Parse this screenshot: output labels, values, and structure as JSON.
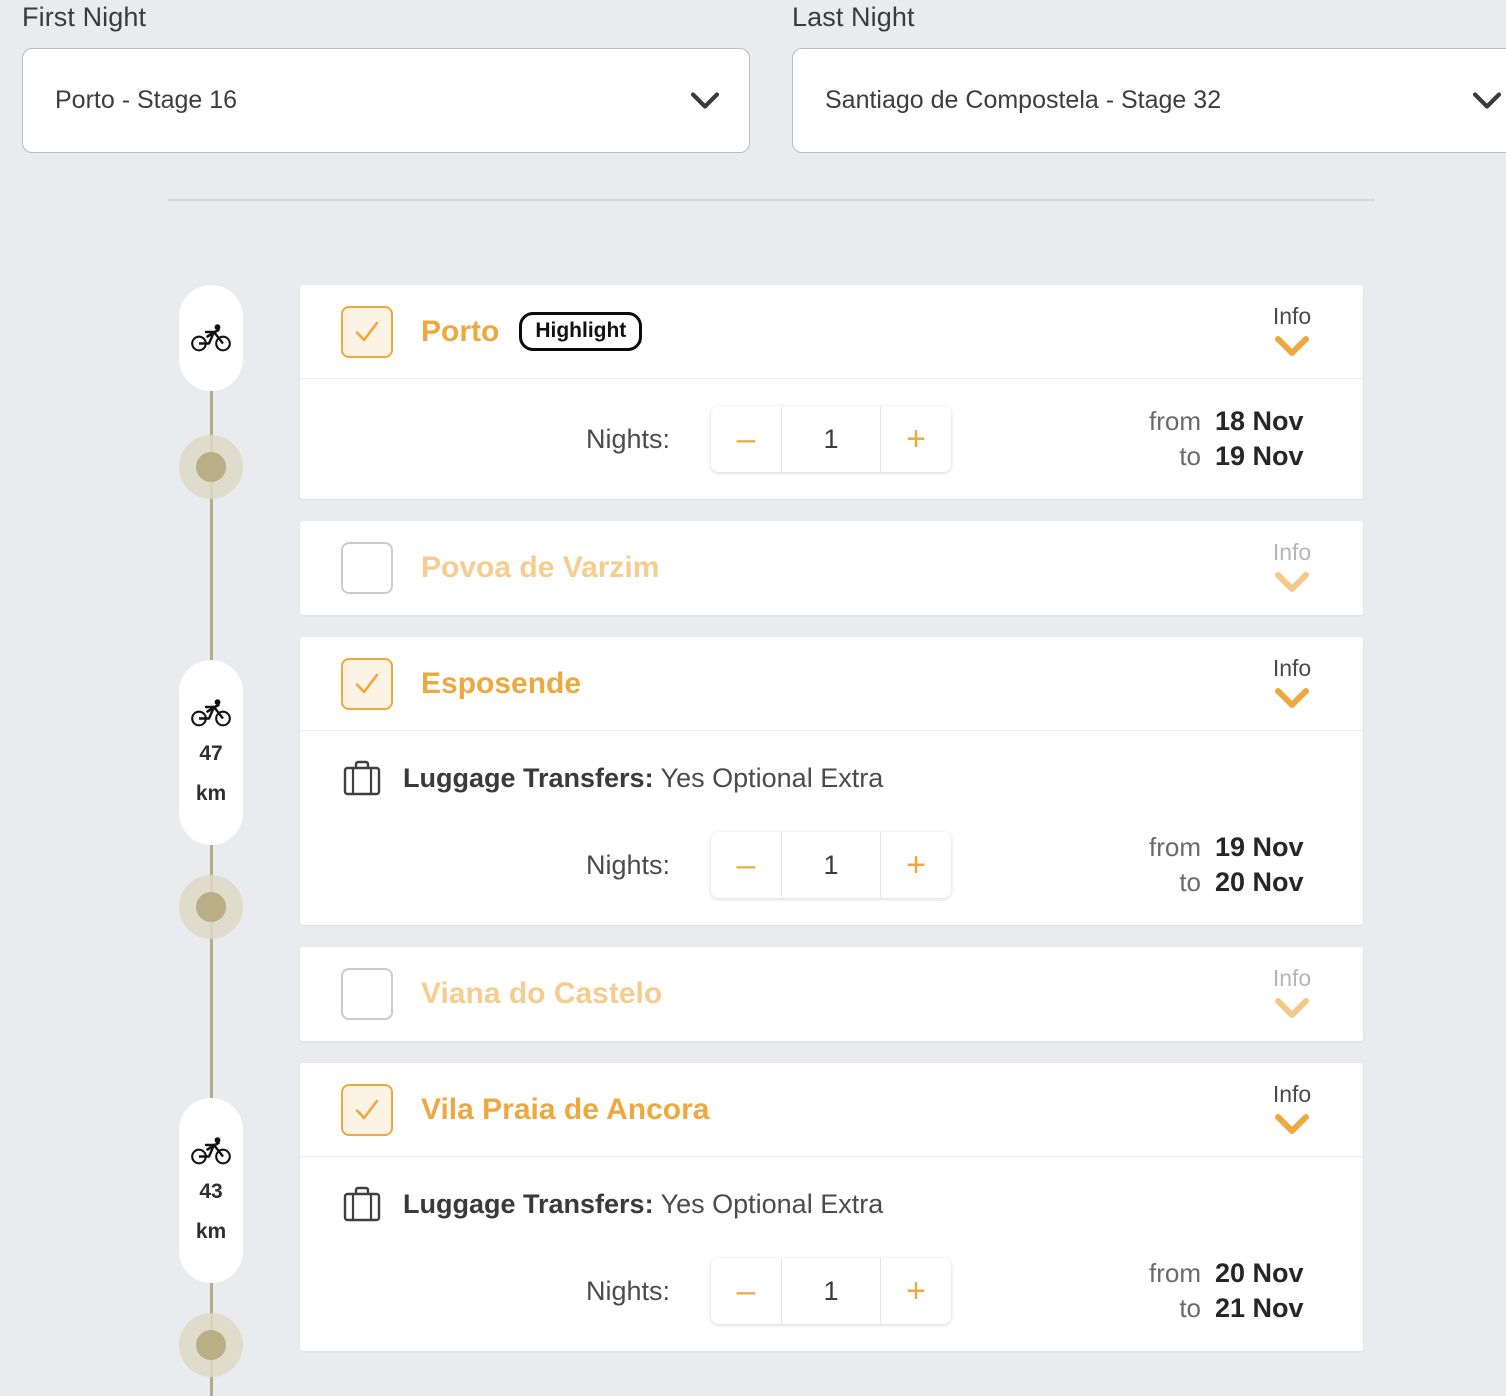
{
  "selectors": {
    "first": {
      "label": "First Night",
      "value": "Porto - Stage 16",
      "icon": "chevron-down-icon"
    },
    "last": {
      "label": "Last Night",
      "value": "Santiago de Compostela - Stage 32",
      "icon": "chevron-down-icon"
    }
  },
  "timeline": {
    "markers": [
      {
        "icon": "bicycle-icon",
        "distance": "",
        "unit": ""
      },
      {
        "icon": "bicycle-icon",
        "distance": "47",
        "unit": "km"
      },
      {
        "icon": "bicycle-icon",
        "distance": "43",
        "unit": "km"
      }
    ],
    "line_color": "#b5ab85",
    "dot_color": "#b9ae86",
    "halo_color": "#ddd9c5"
  },
  "colors": {
    "accent": "#eda93f",
    "accent_muted": "#f5cd8e",
    "background": "#eaebee",
    "card": "#ffffff",
    "text": "#4b4b4b"
  },
  "common": {
    "info_label": "Info",
    "info_icon": "chevron-down-icon",
    "nights_label": "Nights:",
    "minus_label": "–",
    "plus_label": "+",
    "from_label": "from",
    "to_label": "to",
    "luggage_icon": "suitcase-icon",
    "luggage_label": "Luggage Transfers:",
    "check_icon": "check-icon",
    "highlight_badge": "Highlight"
  },
  "stops": [
    {
      "name": "Porto",
      "checked": true,
      "badge": "Highlight",
      "has_badge": true,
      "has_luggage": false,
      "has_nights": true,
      "nights": "1",
      "from": "18 Nov",
      "to": "19 Nov"
    },
    {
      "name": "Povoa de Varzim",
      "checked": false,
      "has_badge": false,
      "has_luggage": false,
      "has_nights": false
    },
    {
      "name": "Esposende",
      "checked": true,
      "has_badge": false,
      "has_luggage": true,
      "luggage_value": "Yes Optional Extra",
      "has_nights": true,
      "nights": "1",
      "from": "19 Nov",
      "to": "20 Nov"
    },
    {
      "name": "Viana do Castelo",
      "checked": false,
      "has_badge": false,
      "has_luggage": false,
      "has_nights": false
    },
    {
      "name": "Vila Praia de Ancora",
      "checked": true,
      "has_badge": false,
      "has_luggage": true,
      "luggage_value": "Yes Optional Extra",
      "has_nights": true,
      "nights": "1",
      "from": "20 Nov",
      "to": "21 Nov"
    }
  ]
}
